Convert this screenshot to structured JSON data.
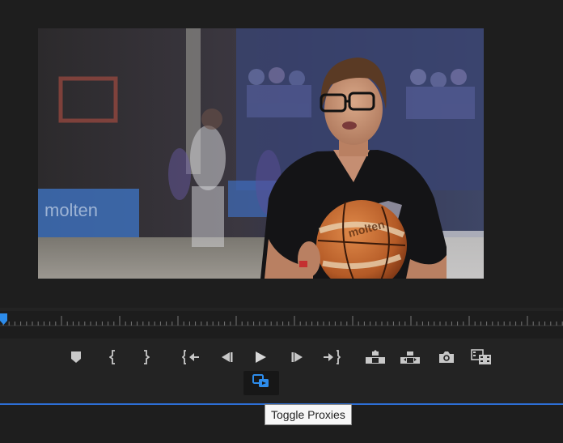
{
  "tooltip": {
    "text": "Toggle Proxies"
  },
  "controls": [
    {
      "name": "add-marker-button",
      "icon": "marker-icon"
    },
    {
      "name": "mark-in-button",
      "icon": "mark-in-icon"
    },
    {
      "name": "mark-out-button",
      "icon": "mark-out-icon"
    },
    {
      "name": "go-to-in-button",
      "icon": "go-to-in-icon"
    },
    {
      "name": "step-back-button",
      "icon": "step-back-icon"
    },
    {
      "name": "play-button",
      "icon": "play-icon"
    },
    {
      "name": "step-forward-button",
      "icon": "step-forward-icon"
    },
    {
      "name": "go-to-out-button",
      "icon": "go-to-out-icon"
    },
    {
      "name": "lift-button",
      "icon": "lift-icon"
    },
    {
      "name": "extract-button",
      "icon": "extract-icon"
    },
    {
      "name": "export-frame-button",
      "icon": "camera-icon"
    },
    {
      "name": "comparison-view-button",
      "icon": "film-compare-icon"
    }
  ],
  "proxy_toggle": {
    "icon": "toggle-proxies-icon",
    "active": true
  },
  "colors": {
    "accent": "#2d8ceb",
    "icon": "#c8c8c8",
    "panel": "#232323"
  }
}
